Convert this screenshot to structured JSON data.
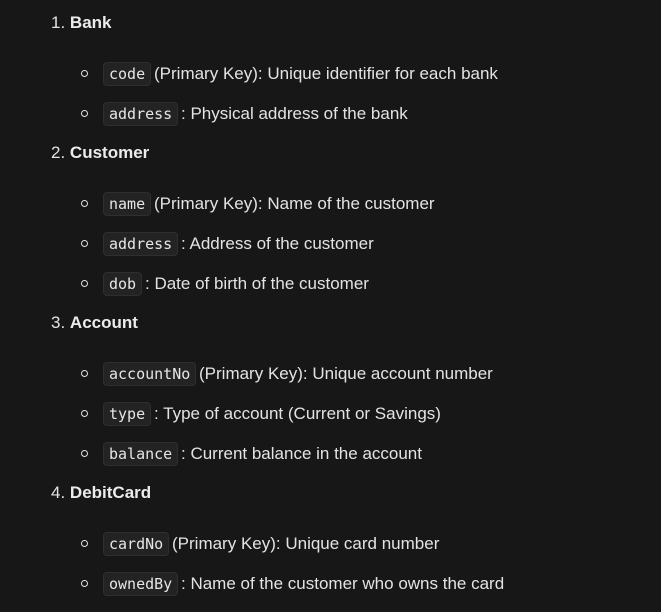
{
  "sections": [
    {
      "number": "1.",
      "title": "Bank",
      "items": [
        {
          "code": "code",
          "text": " (Primary Key): Unique identifier for each bank"
        },
        {
          "code": "address",
          "text": ": Physical address of the bank"
        }
      ]
    },
    {
      "number": "2.",
      "title": "Customer",
      "items": [
        {
          "code": "name",
          "text": " (Primary Key): Name of the customer"
        },
        {
          "code": "address",
          "text": ": Address of the customer"
        },
        {
          "code": "dob",
          "text": ": Date of birth of the customer"
        }
      ]
    },
    {
      "number": "3.",
      "title": "Account",
      "items": [
        {
          "code": "accountNo",
          "text": " (Primary Key): Unique account number"
        },
        {
          "code": "type",
          "text": ": Type of account (Current or Savings)"
        },
        {
          "code": "balance",
          "text": ": Current balance in the account"
        }
      ]
    },
    {
      "number": "4.",
      "title": "DebitCard",
      "items": [
        {
          "code": "cardNo",
          "text": " (Primary Key): Unique card number"
        },
        {
          "code": "ownedBy",
          "text": ": Name of the customer who owns the card"
        }
      ]
    }
  ]
}
